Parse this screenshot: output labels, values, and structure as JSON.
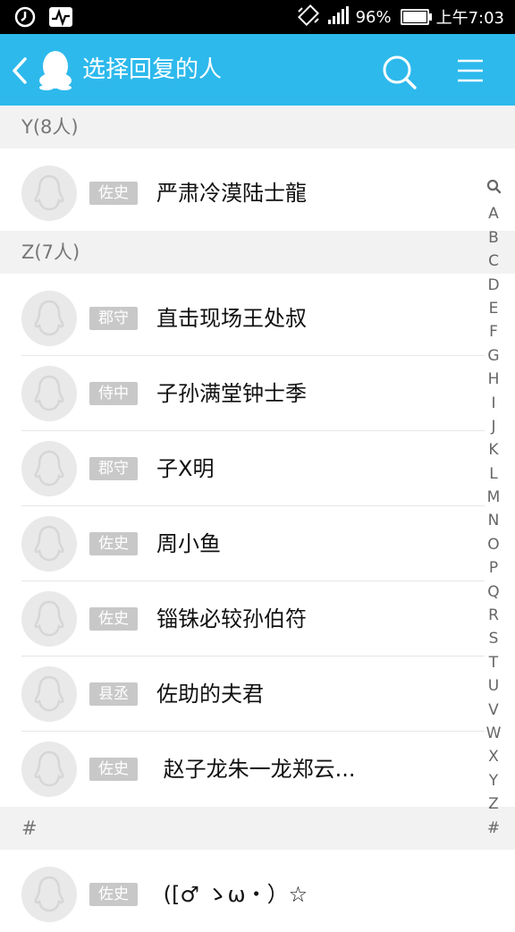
{
  "status_bar": {
    "battery_percent": "96%",
    "battery_level": 0.96,
    "time": "上午7:03",
    "left_icons": [
      "alarm-icon",
      "activity-icon"
    ],
    "right_icons": [
      "vibrate-icon",
      "signal-icon",
      "battery-icon"
    ]
  },
  "header": {
    "title": "选择回复的人",
    "icons": [
      "back-icon",
      "qq-logo-icon",
      "search-icon",
      "menu-icon"
    ],
    "background": "#2db9ec"
  },
  "sections": [
    {
      "title": "Y(8人)",
      "members": [
        {
          "tag": "佐史",
          "name": "严肃冷漠陆士龍"
        }
      ]
    },
    {
      "title": "Z(7人)",
      "members": [
        {
          "tag": "郡守",
          "name": "直击现场王处叔"
        },
        {
          "tag": "侍中",
          "name": "子孙满堂钟士季"
        },
        {
          "tag": "郡守",
          "name": "子X明"
        },
        {
          "tag": "佐史",
          "name": "周小鱼"
        },
        {
          "tag": "佐史",
          "name": "锱铢必较孙伯符"
        },
        {
          "tag": "县丞",
          "name": "佐助的夫君"
        },
        {
          "tag": "佐史",
          "name": " 赵子龙朱一龙郑云..."
        }
      ]
    },
    {
      "title": "#",
      "members": [
        {
          "tag": "佐史",
          "name": " ([♂ ゝω・）☆"
        }
      ]
    }
  ],
  "index_letters": [
    "A",
    "B",
    "C",
    "D",
    "E",
    "F",
    "G",
    "H",
    "I",
    "J",
    "K",
    "L",
    "M",
    "N",
    "O",
    "P",
    "Q",
    "R",
    "S",
    "T",
    "U",
    "V",
    "W",
    "X",
    "Y",
    "Z",
    "#"
  ]
}
